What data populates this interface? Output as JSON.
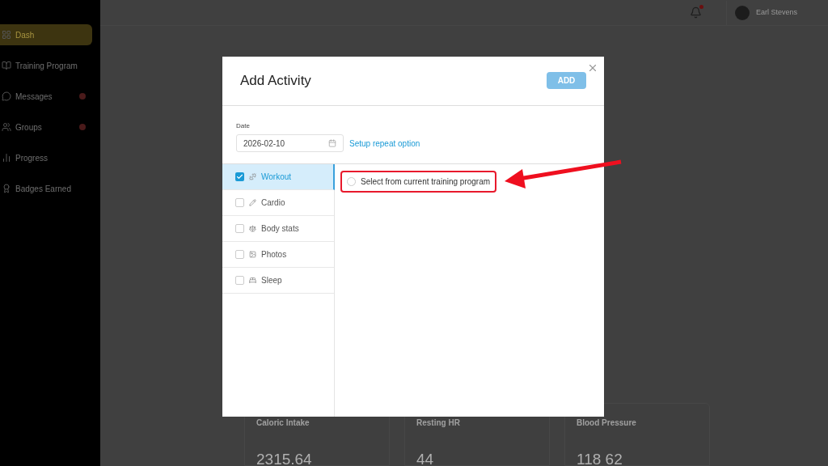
{
  "sidebar": {
    "items": [
      {
        "label": "Dash",
        "selected": true,
        "notification": false
      },
      {
        "label": "Training Program",
        "selected": false,
        "notification": false
      },
      {
        "label": "Messages",
        "selected": false,
        "notification": true
      },
      {
        "label": "Groups",
        "selected": false,
        "notification": true
      },
      {
        "label": "Progress",
        "selected": false,
        "notification": false
      },
      {
        "label": "Badges Earned",
        "selected": false,
        "notification": false
      }
    ]
  },
  "header": {
    "user_name": "Earl Stevens",
    "notification": true
  },
  "stat_cards": [
    {
      "title": "Caloric Intake",
      "value": "2315.64"
    },
    {
      "title": "Resting HR",
      "value": "44"
    },
    {
      "title": "Blood Pressure",
      "value": "118 62"
    }
  ],
  "dialog": {
    "title": "Add Activity",
    "add_button": {
      "label": "ADD",
      "disabled": true
    },
    "date": {
      "label": "Date",
      "value": "2026-02-10"
    },
    "repeat_link": "Setup repeat option",
    "categories": [
      {
        "label": "Workout",
        "checked": true,
        "selected": true
      },
      {
        "label": "Cardio",
        "checked": false,
        "selected": false
      },
      {
        "label": "Body stats",
        "checked": false,
        "selected": false
      },
      {
        "label": "Photos",
        "checked": false,
        "selected": false
      },
      {
        "label": "Sleep",
        "checked": false,
        "selected": false
      }
    ],
    "option": {
      "label": "Select from current training program",
      "selected": false
    }
  }
}
